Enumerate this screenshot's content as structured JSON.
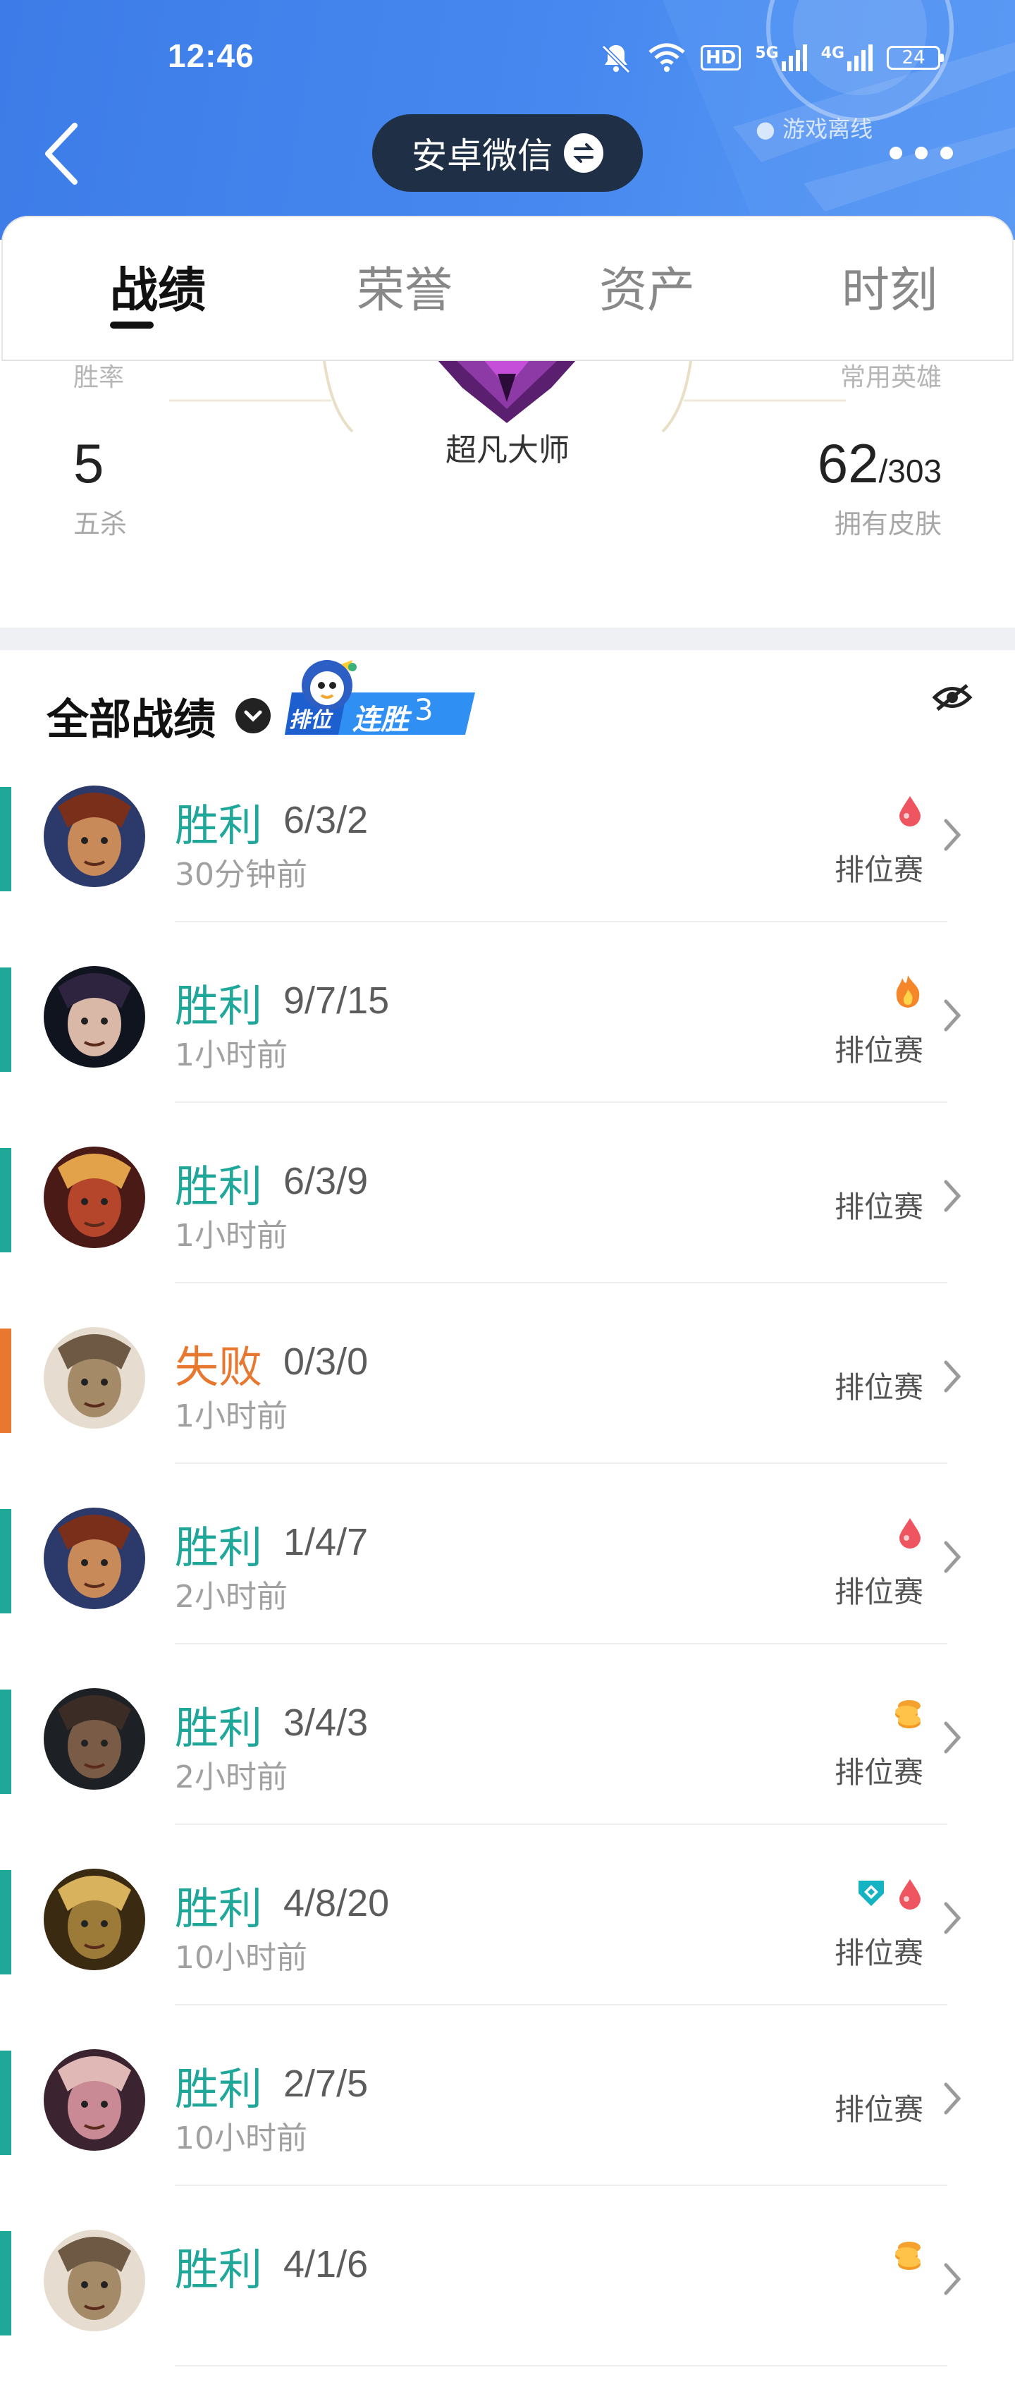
{
  "status_bar": {
    "time": "12:46",
    "battery": "24",
    "network_5g": "5G",
    "network_4g": "4G",
    "hd": "HD"
  },
  "header": {
    "account_switch_label": "安卓微信",
    "offline_status": "游戏离线"
  },
  "tabs": [
    {
      "label": "战绩",
      "active": true
    },
    {
      "label": "荣誉",
      "active": false
    },
    {
      "label": "资产",
      "active": false
    },
    {
      "label": "时刻",
      "active": false
    }
  ],
  "summary": {
    "win_rate_label": "胜率",
    "common_heroes_label": "常用英雄",
    "rank_name": "超凡大师",
    "penta_kills": {
      "value": "5",
      "label": "五杀"
    },
    "skins": {
      "owned": "62",
      "total": "/303",
      "label": "拥有皮肤"
    }
  },
  "match_list": {
    "title": "全部战绩",
    "badge": {
      "left": "排位",
      "right": "连胜",
      "count": "3"
    },
    "items": [
      {
        "result": "胜利",
        "outcome": "win",
        "kda": "6/3/2",
        "time": "30分钟前",
        "mode": "排位赛",
        "tags": [
          "blood-drop"
        ],
        "avatar_icon": "hero-avatar-warrior"
      },
      {
        "result": "胜利",
        "outcome": "win",
        "kda": "9/7/15",
        "time": "1小时前",
        "mode": "排位赛",
        "tags": [
          "flame"
        ],
        "avatar_icon": "hero-avatar-hat"
      },
      {
        "result": "胜利",
        "outcome": "win",
        "kda": "6/3/9",
        "time": "1小时前",
        "mode": "排位赛",
        "tags": [],
        "avatar_icon": "hero-avatar-monkey"
      },
      {
        "result": "失败",
        "outcome": "lose",
        "kda": "0/3/0",
        "time": "1小时前",
        "mode": "排位赛",
        "tags": [],
        "avatar_icon": "hero-avatar-knight"
      },
      {
        "result": "胜利",
        "outcome": "win",
        "kda": "1/4/7",
        "time": "2小时前",
        "mode": "排位赛",
        "tags": [
          "blood-drop"
        ],
        "avatar_icon": "hero-avatar-warrior"
      },
      {
        "result": "胜利",
        "outcome": "win",
        "kda": "3/4/3",
        "time": "2小时前",
        "mode": "排位赛",
        "tags": [
          "coins"
        ],
        "avatar_icon": "hero-avatar-bearded"
      },
      {
        "result": "胜利",
        "outcome": "win",
        "kda": "4/8/20",
        "time": "10小时前",
        "mode": "排位赛",
        "tags": [
          "shield",
          "blood-drop"
        ],
        "avatar_icon": "hero-avatar-beast"
      },
      {
        "result": "胜利",
        "outcome": "win",
        "kda": "2/7/5",
        "time": "10小时前",
        "mode": "排位赛",
        "tags": [],
        "avatar_icon": "hero-avatar-pinkhair"
      },
      {
        "result": "胜利",
        "outcome": "win",
        "kda": "4/1/6",
        "time": "",
        "mode": "",
        "tags": [
          "coins"
        ],
        "avatar_icon": "hero-avatar-knight"
      }
    ]
  },
  "colors": {
    "header_blue": "#4688ef",
    "win": "#1fa79a",
    "lose": "#e8782f",
    "pill_bg": "#1f3046"
  }
}
